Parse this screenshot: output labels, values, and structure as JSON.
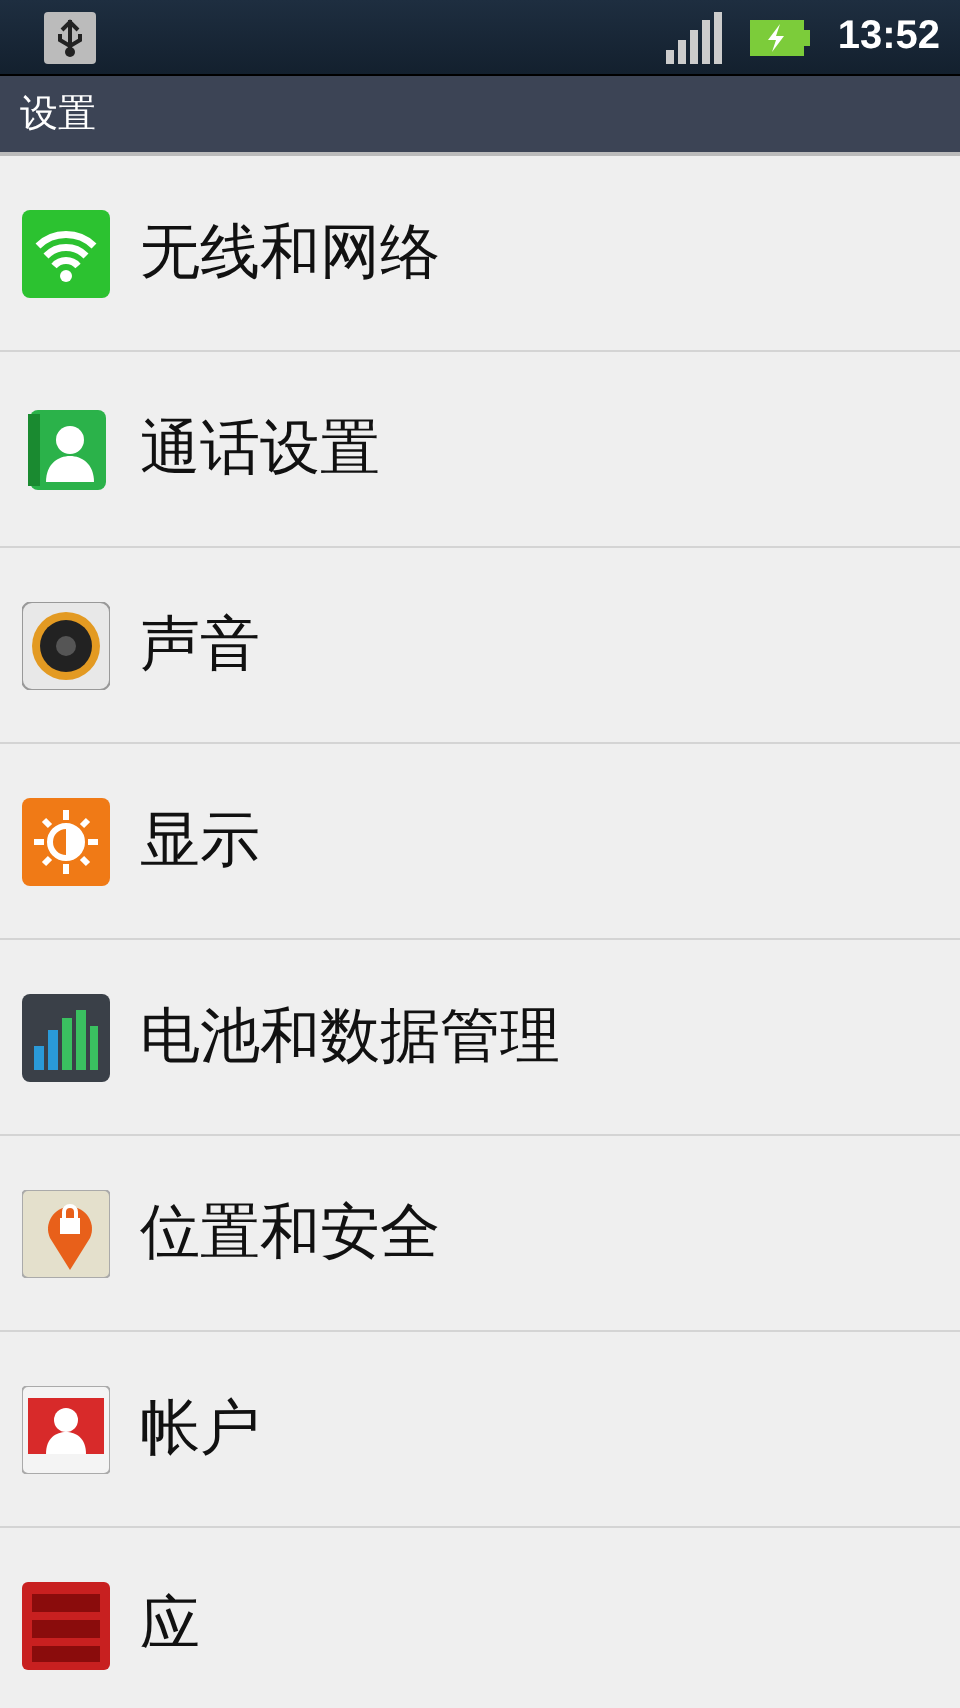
{
  "status_bar": {
    "time": "13:52"
  },
  "title_bar": {
    "title": "设置"
  },
  "items": [
    {
      "kind": "wireless",
      "label": "无线和网络"
    },
    {
      "kind": "call",
      "label": "通话设置"
    },
    {
      "kind": "sound",
      "label": "声音"
    },
    {
      "kind": "display",
      "label": "显示"
    },
    {
      "kind": "battery",
      "label": "电池和数据管理"
    },
    {
      "kind": "location",
      "label": "位置和安全"
    },
    {
      "kind": "account",
      "label": "帐户"
    },
    {
      "kind": "apps",
      "label": "应"
    }
  ]
}
